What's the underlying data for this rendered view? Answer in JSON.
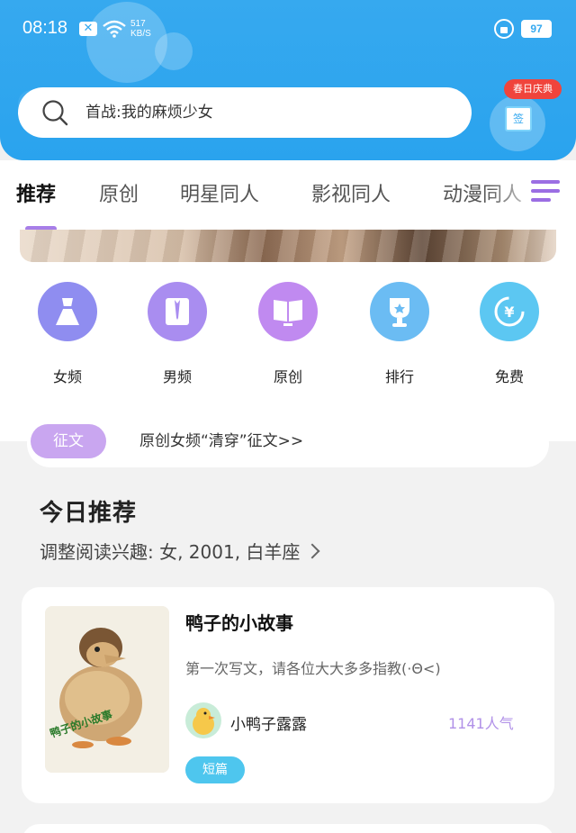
{
  "status_bar": {
    "time": "08:18",
    "notif_icon": "x-icon",
    "net_speed_value": "517",
    "net_speed_unit": "KB/S",
    "battery": "97"
  },
  "search": {
    "placeholder": "首战:我的麻烦少女"
  },
  "gift": {
    "badge": "春日庆典",
    "box_label": "签"
  },
  "tabs": [
    {
      "label": "推荐",
      "active": true
    },
    {
      "label": "原创",
      "active": false
    },
    {
      "label": "明星同人",
      "active": false
    },
    {
      "label": "影视同人",
      "active": false
    },
    {
      "label": "动漫同人",
      "active": false
    }
  ],
  "categories": [
    {
      "label": "女频",
      "icon": "dress-icon",
      "color": "#8f8df0"
    },
    {
      "label": "男频",
      "icon": "shirt-icon",
      "color": "#a98df0"
    },
    {
      "label": "原创",
      "icon": "book-icon",
      "color": "#c08af0"
    },
    {
      "label": "排行",
      "icon": "trophy-icon",
      "color": "#6bbcf3"
    },
    {
      "label": "免费",
      "icon": "yuan-icon",
      "color": "#5cc7f2"
    }
  ],
  "notice": {
    "tag": "征文",
    "text": "原创女频“清穿”征文>>"
  },
  "section": {
    "title": "今日推荐",
    "subtitle": "调整阅读兴趣: 女, 2001, 白羊座"
  },
  "card": {
    "title": "鸭子的小故事",
    "description": "第一次写文，请各位大大多多指教(·Θ<)",
    "author": "小鸭子露露",
    "popularity": "1141人气",
    "tag": "短篇",
    "cover_caption": "鸭子的小故事"
  }
}
